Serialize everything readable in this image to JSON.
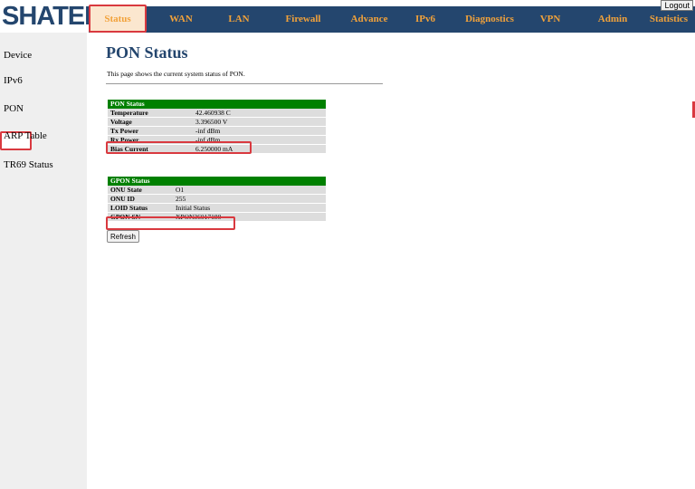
{
  "brand": {
    "logo_text": "SHATEL"
  },
  "header": {
    "logout_label": "Logout"
  },
  "nav": {
    "items": [
      {
        "label": "Status",
        "active": true
      },
      {
        "label": "WAN"
      },
      {
        "label": "LAN"
      },
      {
        "label": "Firewall"
      },
      {
        "label": "Advance"
      },
      {
        "label": "IPv6"
      },
      {
        "label": "Diagnostics"
      },
      {
        "label": "VPN"
      },
      {
        "label": "Admin"
      },
      {
        "label": "Statistics"
      }
    ]
  },
  "sidebar": {
    "items": [
      {
        "label": "Device"
      },
      {
        "label": "IPv6"
      },
      {
        "label": "PON",
        "active": true
      },
      {
        "label": "ARP Table"
      },
      {
        "label": "TR69 Status"
      }
    ]
  },
  "page": {
    "title": "PON Status",
    "description": "This page shows the current system status of PON."
  },
  "pon_table": {
    "header": "PON Status",
    "rows": [
      {
        "label": "Temperature",
        "value": "42.460938 C"
      },
      {
        "label": "Voltage",
        "value": "3.396500 V"
      },
      {
        "label": "Tx Power",
        "value": "-inf dBm"
      },
      {
        "label": "Rx Power",
        "value": "-inf dBm"
      },
      {
        "label": "Bias Current",
        "value": "6.250000 mA"
      }
    ]
  },
  "gpon_table": {
    "header": "GPON Status",
    "rows": [
      {
        "label": "ONU State",
        "value": "O1"
      },
      {
        "label": "ONU ID",
        "value": "255"
      },
      {
        "label": "LOID Status",
        "value": "Initial Status"
      },
      {
        "label": "GPON SN",
        "value": "XPON36017180"
      }
    ]
  },
  "buttons": {
    "refresh_label": "Refresh"
  },
  "colors": {
    "navbar_bg": "#24466e",
    "nav_text": "#f2a23a",
    "table_header_bg": "#008000",
    "highlight_border": "#d9393f"
  }
}
